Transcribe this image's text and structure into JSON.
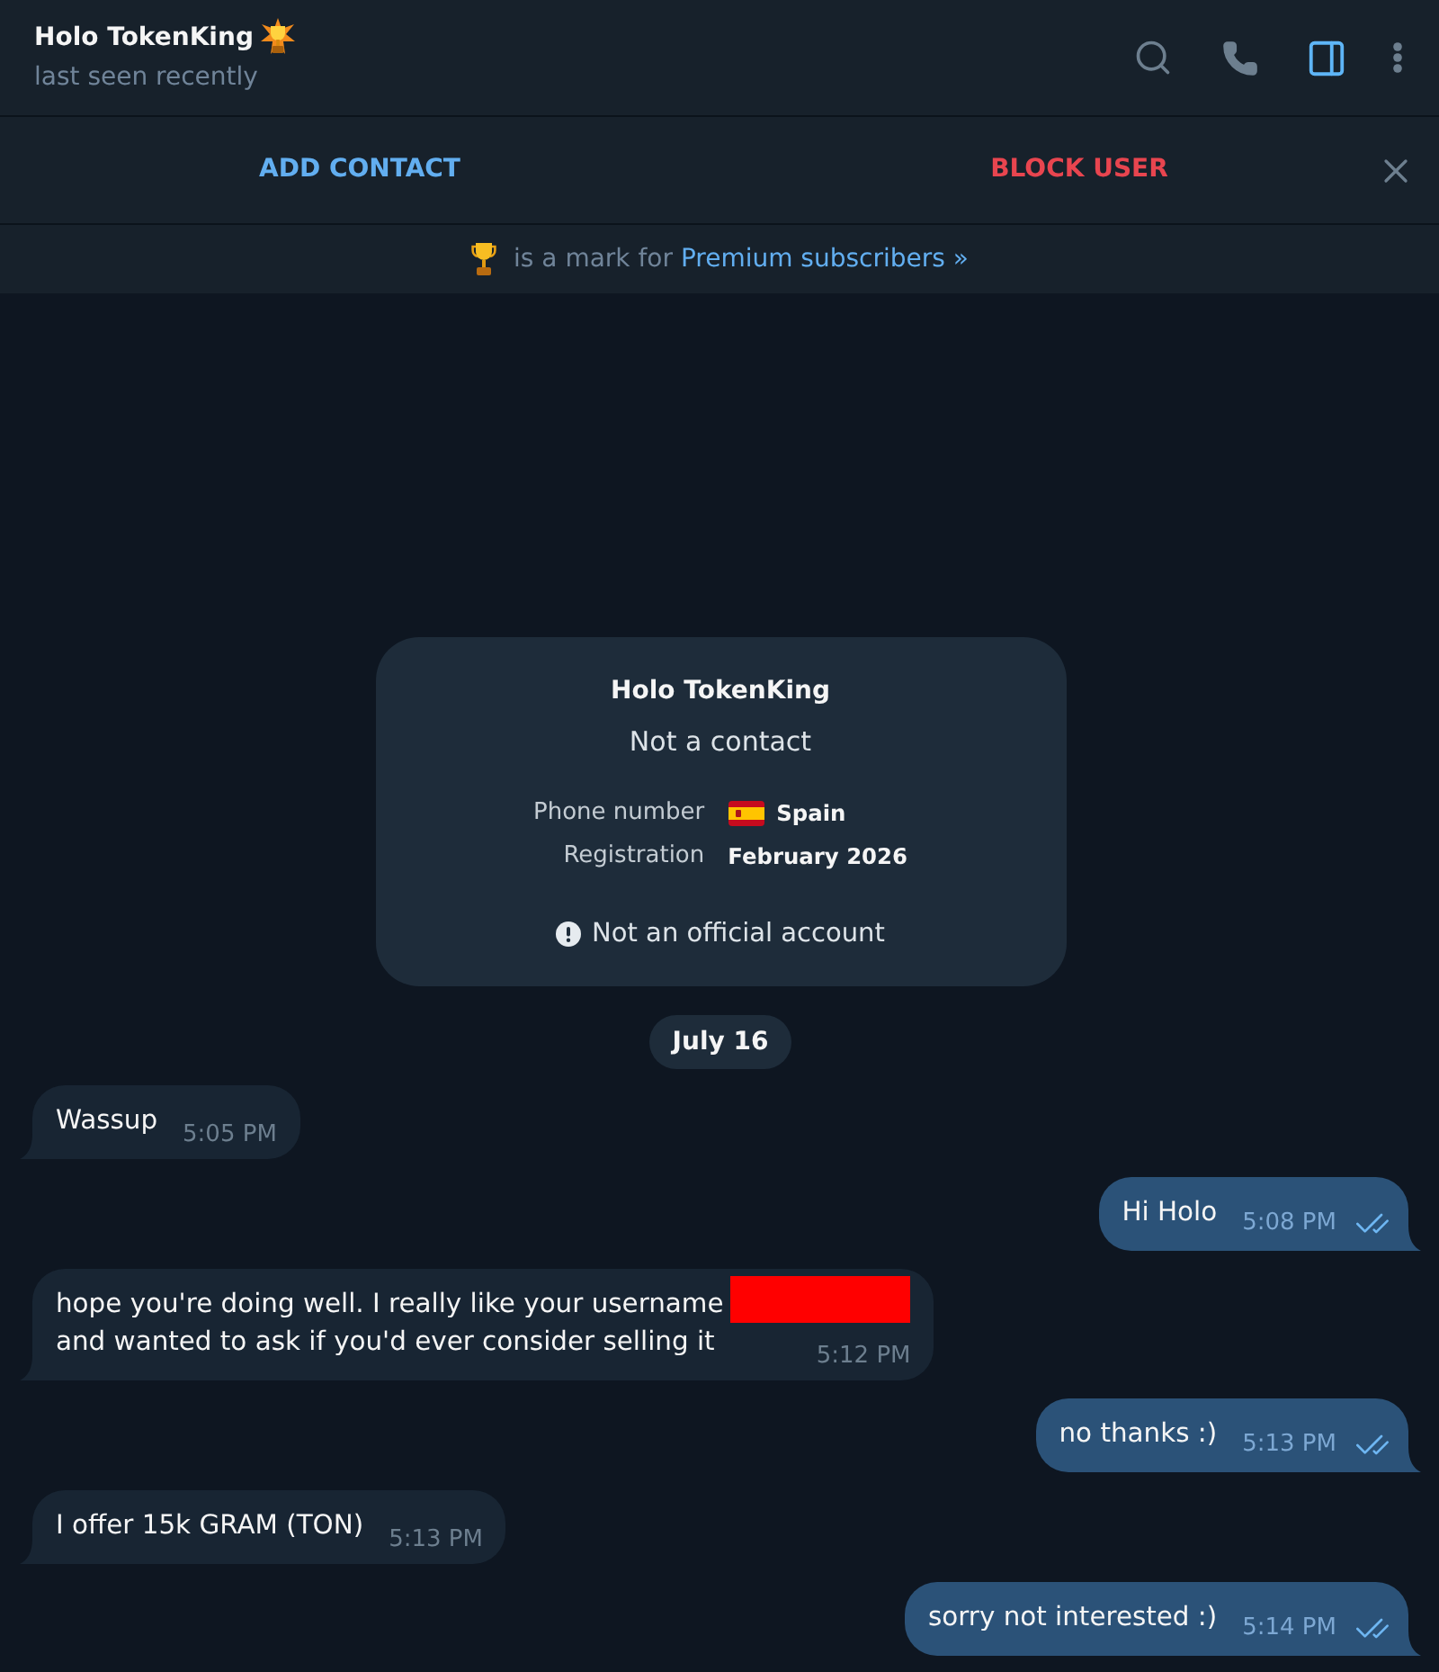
{
  "header": {
    "title": "Holo TokenKing",
    "status": "last seen recently",
    "profile_panel_open": true
  },
  "action_bar": {
    "add_contact": "ADD CONTACT",
    "block_user": "BLOCK USER"
  },
  "premium_notice": {
    "text": "is a mark for",
    "link": "Premium subscribers »"
  },
  "info_card": {
    "name": "Holo TokenKing",
    "subtitle": "Not a contact",
    "rows": [
      {
        "kind": "country",
        "label": "Phone number",
        "value": "Spain"
      },
      {
        "kind": "date",
        "label": "Registration",
        "value": "February 2026"
      }
    ],
    "warning": "Not an official account"
  },
  "date_separator": "July 16",
  "messages": [
    {
      "kind": "incoming",
      "lines": [
        "Wassup"
      ],
      "time": "5:05 PM"
    },
    {
      "kind": "outgoing",
      "lines": [
        "Hi Holo"
      ],
      "time": "5:08 PM",
      "read": true
    },
    {
      "kind": "incoming",
      "lines": [
        "hope you're doing well. I really like your username",
        "and wanted to ask if you'd ever consider selling it"
      ],
      "time": "5:12 PM",
      "redacted": true
    },
    {
      "kind": "outgoing",
      "lines": [
        "no thanks :)"
      ],
      "time": "5:13 PM",
      "read": true
    },
    {
      "kind": "incoming",
      "lines": [
        "I offer 15k GRAM (TON)"
      ],
      "time": "5:13 PM"
    },
    {
      "kind": "outgoing",
      "lines": [
        "sorry not interested :)"
      ],
      "time": "5:14 PM",
      "read": true
    }
  ]
}
